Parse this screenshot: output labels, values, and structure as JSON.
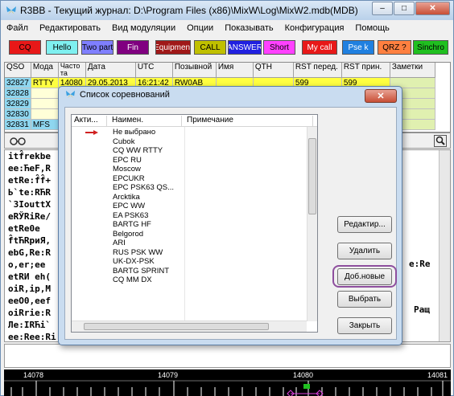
{
  "window": {
    "title": "R3BB - Текущий журнал: D:\\Program Files (x86)\\MixW\\Log\\MixW2.mdb(MDB)",
    "min": "–",
    "max": "□",
    "close": "✕"
  },
  "menu": [
    "Файл",
    "Редактировать",
    "Вид модуляции",
    "Опции",
    "Показывать",
    "Конфигурация",
    "Помощь"
  ],
  "toolbar": [
    {
      "label": "CQ",
      "bg": "#e81818",
      "fg": "#000"
    },
    {
      "label": "Hello",
      "bg": "#7ff0f0",
      "fg": "#000"
    },
    {
      "label": "Two part",
      "bg": "#7f7fff",
      "fg": "#000"
    },
    {
      "label": "Fin",
      "bg": "#800080",
      "fg": "#fff"
    },
    {
      "label": "Equipment",
      "bg": "#a01818",
      "fg": "#fff"
    },
    {
      "label": "CALL",
      "bg": "#c0c000",
      "fg": "#000"
    },
    {
      "label": "ANSWER",
      "bg": "#2020e0",
      "fg": "#fff"
    },
    {
      "label": "Short",
      "bg": "#ff40ff",
      "fg": "#000"
    },
    {
      "label": "My call",
      "bg": "#e81818",
      "fg": "#fff"
    },
    {
      "label": "Pse k",
      "bg": "#2080e0",
      "fg": "#fff"
    },
    {
      "label": "QRZ ?",
      "bg": "#ff8040",
      "fg": "#000"
    },
    {
      "label": "Sinchro",
      "bg": "#20c020",
      "fg": "#000"
    }
  ],
  "log": {
    "columns": [
      "QSO",
      "Мода",
      "Часто\nта",
      "Дата",
      "UTC",
      "Позывной",
      "Имя",
      "QTH",
      "RST перед.",
      "RST прин.",
      "Заметки"
    ],
    "rows": [
      [
        "32827",
        "RTTY",
        "14080",
        "29.05.2013",
        "16:21:42",
        "RW0AB",
        "",
        "",
        "599",
        "599",
        ""
      ],
      [
        "32828",
        "",
        "",
        "",
        "",
        "",
        "",
        "",
        "",
        "",
        ""
      ],
      [
        "32829",
        "",
        "",
        "",
        "",
        "",
        "",
        "",
        "",
        "",
        ""
      ],
      [
        "32830",
        "",
        "",
        "",
        "",
        "",
        "",
        "",
        "",
        "",
        ""
      ],
      [
        "32831",
        "MFS",
        "",
        "",
        "",
        "",
        "",
        "",
        "",
        "",
        ""
      ]
    ]
  },
  "rx": {
    "lines": [
      "itf̂rekbe",
      "ee:ЋeF,R",
      "etRe:f̂f̂+",
      "Ь`te:RЋR",
      "`3IouttX",
      "eRЎRiRe/",
      "  etRe0e",
      "f̂tЋRpиЯ,",
      "ebG,Re:R",
      "o,er;ee",
      "etRИ eh(",
      "oiR,ip,M",
      "eeO0,eef",
      "oiRrie:R",
      "Лe:IRЋi`",
      "ee:Ree:Ri"
    ],
    "right1": "e:Re",
    "right2": "Ращ"
  },
  "waterfall": {
    "ticks": [
      "14078",
      "14079",
      "14080",
      "14081"
    ]
  },
  "dialog": {
    "title": "Список соревнований",
    "close": "✕",
    "headers": [
      "Акти...",
      "Наимен.",
      "Примечание"
    ],
    "items": [
      "Не выбрано",
      "Cubok",
      "CQ WW RTTY",
      "EPC RU",
      "Moscow",
      "EPCUKR",
      "EPC PSK63 QS...",
      "Arcktika",
      "EPC WW",
      "EA PSK63",
      "BARTG HF",
      "Belgorod",
      "ARI",
      "RUS PSK WW",
      "UK-DX-PSK",
      "BARTG SPRINT",
      "CQ MM DX"
    ],
    "buttons": {
      "edit": "Редактир...",
      "delete": "Удалить",
      "add_new": "Доб.новые",
      "select": "Выбрать",
      "close": "Закрыть"
    }
  }
}
